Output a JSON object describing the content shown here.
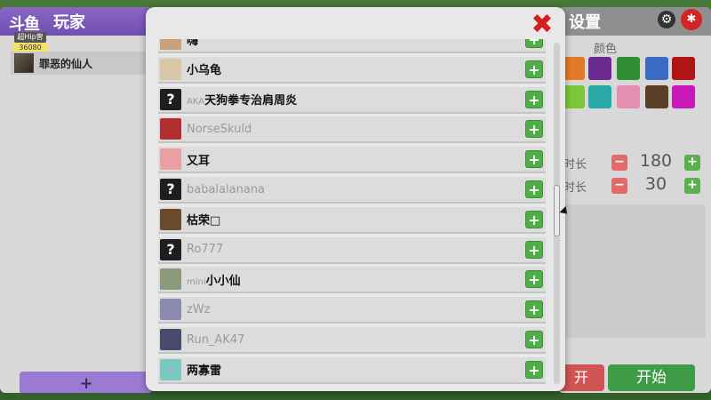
{
  "left_panel": {
    "logo": "斗鱼",
    "title": "玩家",
    "badge_level": "超Hip曾",
    "badge_num": "36080",
    "player_name": "罪恶的仙人",
    "add_label": "+"
  },
  "right_panel": {
    "title": "设置",
    "color_label": "颜色",
    "colors": [
      "#e27a2a",
      "#6b2a8f",
      "#2f8f32",
      "#3a6ac4",
      "#b01515",
      "#7cc63a",
      "#2aa8a8",
      "#e48eb2",
      "#5a3e26",
      "#c818b8"
    ],
    "timer1": {
      "label": "时长",
      "value": "180",
      "minus": "−",
      "plus": "+"
    },
    "timer2": {
      "label": "时长",
      "value": "30",
      "minus": "−",
      "plus": "+"
    },
    "btn_left": "开",
    "btn_start": "开始"
  },
  "modal": {
    "close": "✖",
    "rows": [
      {
        "name": "嗨",
        "bold": true,
        "unknown": false,
        "avatar": "#c9a07a"
      },
      {
        "name": "小乌龟",
        "bold": true,
        "unknown": false,
        "avatar": "#d8c7a6"
      },
      {
        "prefix": "AKA",
        "name": "天狗拳专治肩周炎",
        "bold": true,
        "unknown": true
      },
      {
        "name": "NorseSkuld",
        "bold": false,
        "unknown": false,
        "avatar": "#b03030"
      },
      {
        "name": "又耳",
        "bold": true,
        "unknown": false,
        "avatar": "#e8a0a0"
      },
      {
        "name": "babalalanana",
        "bold": false,
        "unknown": true
      },
      {
        "name": "枯荣□",
        "bold": true,
        "unknown": false,
        "avatar": "#6b4a2a"
      },
      {
        "name": "Ro777",
        "bold": false,
        "unknown": true
      },
      {
        "prefix": "mini",
        "name": "小小仙",
        "bold": true,
        "unknown": false,
        "avatar": "#8a9a7a"
      },
      {
        "name": "zWz",
        "bold": false,
        "unknown": false,
        "avatar": "#8a8ab0"
      },
      {
        "name": "Run_AK47",
        "bold": false,
        "unknown": false,
        "avatar": "#4a4a6a"
      },
      {
        "name": "两寡雷",
        "bold": true,
        "unknown": false,
        "avatar": "#7ac8c0"
      }
    ],
    "add_label": "+",
    "unknown_glyph": "?"
  },
  "icons": {
    "gear": "gear-icon",
    "bug": "bug-icon"
  }
}
